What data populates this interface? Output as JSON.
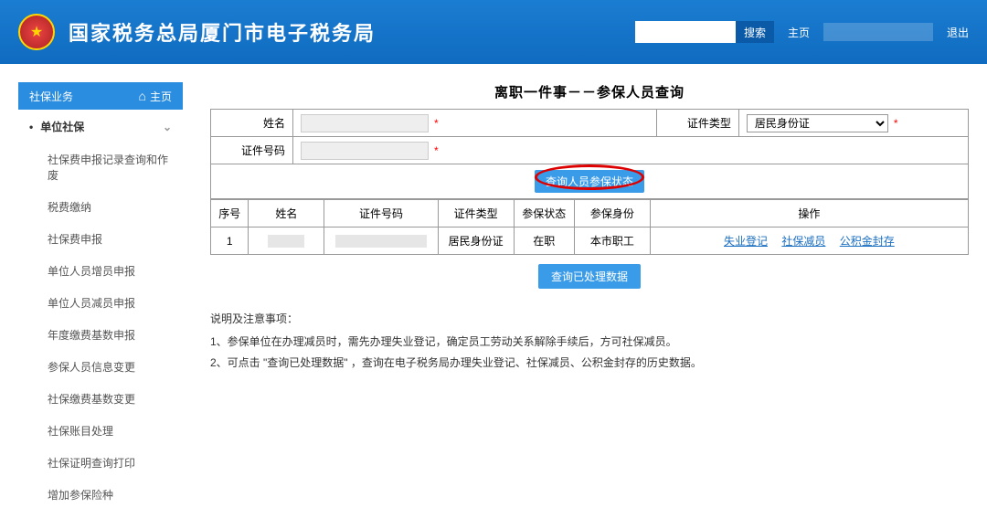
{
  "header": {
    "site_title": "国家税务总局厦门市电子税务局",
    "search_placeholder": "",
    "search_btn": "搜索",
    "home_link": "主页",
    "logout_link": "退出"
  },
  "sidebar": {
    "header_label": "社保业务",
    "home_label": "主页",
    "parent_label": "单位社保",
    "items": [
      "社保费申报记录查询和作废",
      "税费缴纳",
      "社保费申报",
      "单位人员增员申报",
      "单位人员减员申报",
      "年度缴费基数申报",
      "参保人员信息变更",
      "社保缴费基数变更",
      "社保账目处理",
      "社保证明查询打印",
      "增加参保险种"
    ]
  },
  "main": {
    "page_title": "离职一件事－－参保人员查询",
    "form": {
      "name_label": "姓名",
      "id_type_label": "证件类型",
      "id_type_value": "居民身份证",
      "id_no_label": "证件号码"
    },
    "query_btn": "查询人员参保状态",
    "table": {
      "headers": [
        "序号",
        "姓名",
        "证件号码",
        "证件类型",
        "参保状态",
        "参保身份",
        "操作"
      ],
      "rows": [
        {
          "seq": "1",
          "name": "",
          "id_no": "",
          "id_type": "居民身份证",
          "status": "在职",
          "identity": "本市职工"
        }
      ],
      "ops": [
        "失业登记",
        "社保减员",
        "公积金封存"
      ]
    },
    "processed_btn": "查询已处理数据",
    "notes": {
      "title": "说明及注意事项：",
      "items": [
        "1、参保单位在办理减员时，需先办理失业登记，确定员工劳动关系解除手续后，方可社保减员。",
        "2、可点击 \"查询已处理数据\" ，查询在电子税务局办理失业登记、社保减员、公积金封存的历史数据。"
      ]
    }
  }
}
